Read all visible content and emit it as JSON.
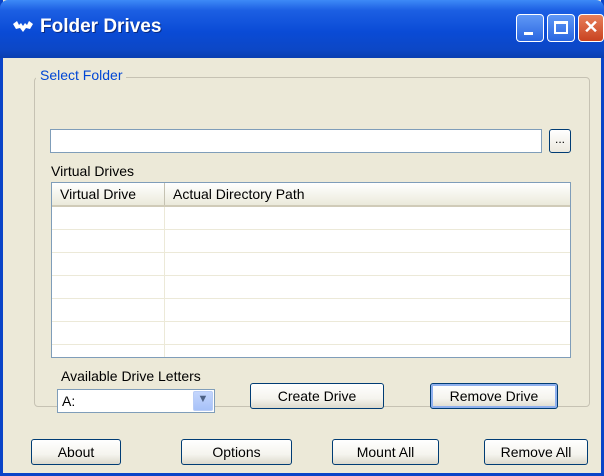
{
  "window": {
    "title": "Folder Drives",
    "app_icon": "bat-icon"
  },
  "select_folder": {
    "group_label": "Select Folder",
    "path_value": "",
    "browse_label": "..."
  },
  "virtual_drives": {
    "label": "Virtual Drives",
    "columns": [
      "Virtual Drive",
      "Actual Directory Path"
    ],
    "rows": []
  },
  "drive_letters": {
    "label": "Available Drive Letters",
    "selected": "A:"
  },
  "buttons": {
    "create_drive": "Create Drive",
    "remove_drive": "Remove Drive",
    "about": "About",
    "options": "Options",
    "mount_all": "Mount All",
    "remove_all": "Remove All"
  },
  "colors": {
    "titlebar": "#0a4bd6",
    "group_label": "#0046d5",
    "face": "#ece9d8"
  }
}
